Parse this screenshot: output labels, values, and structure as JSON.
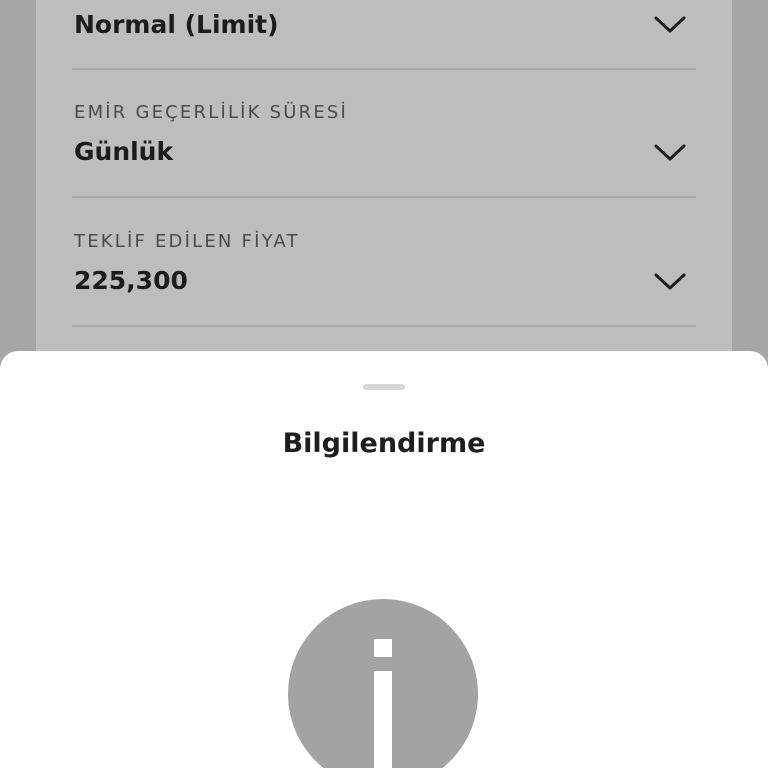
{
  "form": {
    "order_type": {
      "value": "Normal (Limit)"
    },
    "validity": {
      "label": "EMİR GEÇERLİLİK SÜRESİ",
      "value": "Günlük"
    },
    "price": {
      "label": "TEKLİF EDİLEN FİYAT",
      "value": "225,300"
    }
  },
  "sheet": {
    "title": "Bilgilendirme",
    "icon": "info-icon"
  },
  "colors": {
    "overlay_background": "#a6a6a6",
    "form_background": "#bdbdbd",
    "sheet_background": "#ffffff",
    "info_icon_fill": "#a3a3a3"
  }
}
